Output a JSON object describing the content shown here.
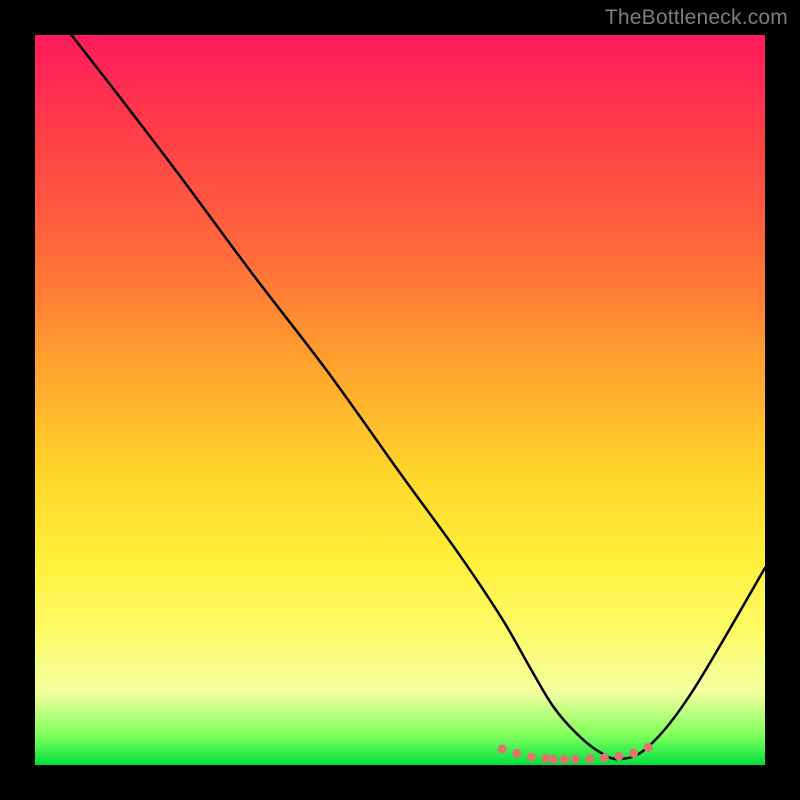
{
  "watermark": "TheBottleneck.com",
  "chart_data": {
    "type": "line",
    "title": "",
    "xlabel": "",
    "ylabel": "",
    "xlim": [
      0,
      100
    ],
    "ylim": [
      0,
      100
    ],
    "series": [
      {
        "name": "curve",
        "x": [
          5,
          12,
          20,
          30,
          40,
          50,
          58,
          64,
          68,
          71,
          74,
          77,
          80,
          84,
          90,
          100
        ],
        "values": [
          100,
          91,
          80.5,
          67,
          54,
          40,
          29,
          20,
          13,
          8,
          4.5,
          2,
          0.8,
          2.5,
          10,
          27
        ]
      }
    ],
    "markers": {
      "name": "highlight-dots",
      "color": "#e0756d",
      "x": [
        64,
        66,
        68,
        70,
        71,
        72.5,
        74,
        76,
        78,
        80,
        82,
        84
      ],
      "values": [
        2.2,
        1.6,
        1.1,
        0.9,
        0.8,
        0.8,
        0.8,
        0.9,
        1.0,
        1.2,
        1.6,
        2.4
      ]
    }
  }
}
